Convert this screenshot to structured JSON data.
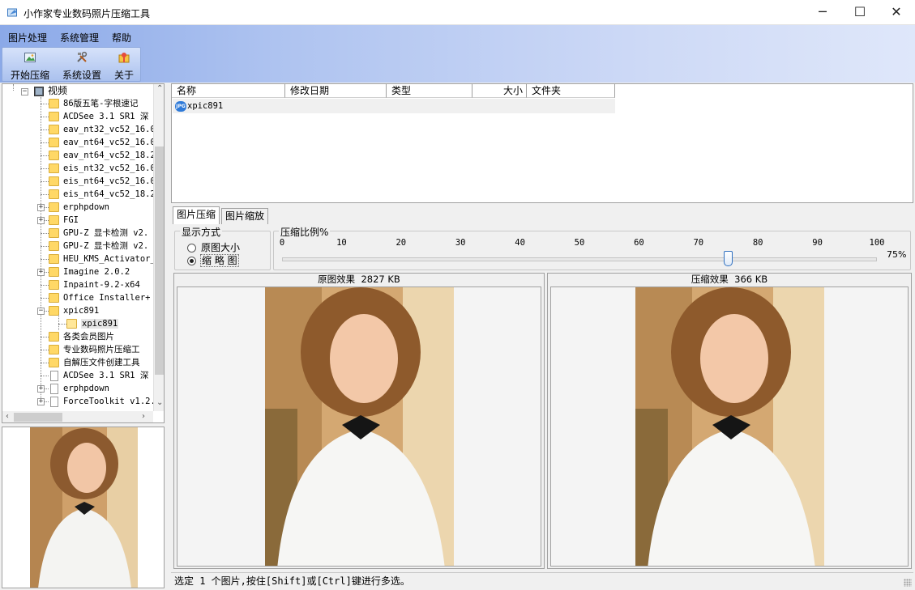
{
  "window": {
    "title": "小作家专业数码照片压缩工具",
    "minimize_glyph": "─",
    "maximize_glyph": "☐",
    "close_glyph": "✕"
  },
  "menu": {
    "items": [
      "图片处理",
      "系统管理",
      "帮助"
    ]
  },
  "toolbar": {
    "buttons": [
      {
        "label": "开始压缩",
        "icon": "picture-icon"
      },
      {
        "label": "系统设置",
        "icon": "tools-icon"
      },
      {
        "label": "关于",
        "icon": "about-icon"
      }
    ]
  },
  "tree": {
    "root_label": "视频",
    "items": [
      {
        "label": "86版五笔-字根速记",
        "kind": "folder",
        "expander": false
      },
      {
        "label": "ACDSee 3.1 SR1 深",
        "kind": "folder",
        "expander": false
      },
      {
        "label": "eav_nt32_vc52_16.0",
        "kind": "folder",
        "expander": false
      },
      {
        "label": "eav_nt64_vc52_16.0",
        "kind": "folder",
        "expander": false
      },
      {
        "label": "eav_nt64_vc52_18.2",
        "kind": "folder",
        "expander": false
      },
      {
        "label": "eis_nt32_vc52_16.0",
        "kind": "folder",
        "expander": false
      },
      {
        "label": "eis_nt64_vc52_16.0",
        "kind": "folder",
        "expander": false
      },
      {
        "label": "eis_nt64_vc52_18.2",
        "kind": "folder",
        "expander": false
      },
      {
        "label": "erphpdown",
        "kind": "folder",
        "expander": true
      },
      {
        "label": "FGI",
        "kind": "folder",
        "expander": true
      },
      {
        "label": "GPU-Z 显卡检测 v2.",
        "kind": "folder",
        "expander": false
      },
      {
        "label": "GPU-Z 显卡检测 v2.",
        "kind": "folder",
        "expander": false
      },
      {
        "label": "HEU_KMS_Activator_",
        "kind": "folder",
        "expander": false
      },
      {
        "label": "Imagine 2.0.2",
        "kind": "folder",
        "expander": true
      },
      {
        "label": "Inpaint-9.2-x64",
        "kind": "folder",
        "expander": false
      },
      {
        "label": "Office Installer+",
        "kind": "folder",
        "expander": false
      },
      {
        "label": "xpic891",
        "kind": "folder",
        "expander": true,
        "expanded": true
      },
      {
        "label": "xpic891",
        "kind": "folder-open",
        "expander": false,
        "child": true,
        "selected": true
      },
      {
        "label": "各类会员图片",
        "kind": "folder",
        "expander": false
      },
      {
        "label": "专业数码照片压缩工",
        "kind": "folder",
        "expander": false
      },
      {
        "label": "自解压文件创建工具",
        "kind": "folder",
        "expander": false
      },
      {
        "label": "ACDSee 3.1 SR1 深",
        "kind": "doc",
        "expander": false
      },
      {
        "label": "erphpdown",
        "kind": "doc",
        "expander": true
      },
      {
        "label": "ForceToolkit v1.2.",
        "kind": "doc",
        "expander": true
      }
    ]
  },
  "filelist": {
    "columns": [
      "名称",
      "修改日期",
      "类型",
      "大小",
      "文件夹"
    ],
    "rows": [
      {
        "name": "xpic891",
        "icon": "jpg-file-icon"
      }
    ]
  },
  "tabs": [
    "图片压缩",
    "图片缩放"
  ],
  "display_mode": {
    "title": "显示方式",
    "options": [
      "原图大小",
      "缩 略 图"
    ],
    "selected_index": 1
  },
  "compression": {
    "title": "压缩比例%",
    "ticks": [
      "0",
      "10",
      "20",
      "30",
      "40",
      "50",
      "60",
      "70",
      "80",
      "90",
      "100"
    ],
    "value": 75,
    "value_label": "75%"
  },
  "previews": {
    "original": {
      "label": "原图效果",
      "size": "2827 KB"
    },
    "compressed": {
      "label": "压缩效果",
      "size": "366 KB"
    }
  },
  "status": {
    "text": "选定 1 个图片,按住[Shift]或[Ctrl]键进行多选。"
  }
}
